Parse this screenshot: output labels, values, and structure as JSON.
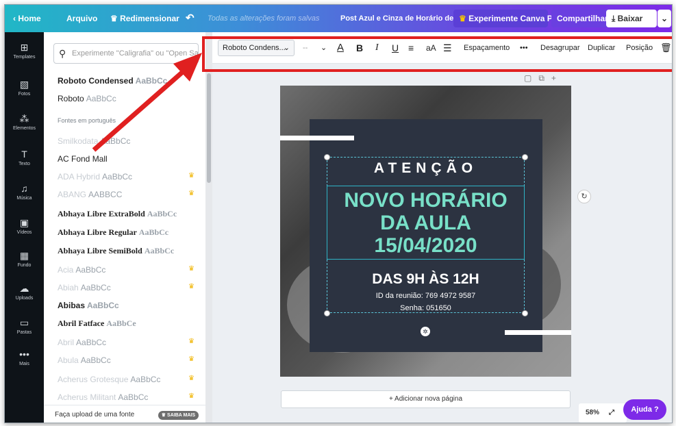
{
  "topbar": {
    "home": "Home",
    "arquivo": "Arquivo",
    "redimensionar": "Redimensionar",
    "saved_status": "Todas as alterações foram salvas",
    "doc_title": "Post Azul e Cinza de Horário de",
    "pro_label": "Experimente Canva Pro",
    "share_label": "Compartilhar",
    "download_label": "Baixar"
  },
  "rail": [
    {
      "label": "Templates",
      "icon": "templates-icon"
    },
    {
      "label": "Fotos",
      "icon": "photos-icon"
    },
    {
      "label": "Elementos",
      "icon": "elements-icon"
    },
    {
      "label": "Texto",
      "icon": "text-icon"
    },
    {
      "label": "Música",
      "icon": "music-icon"
    },
    {
      "label": "Vídeos",
      "icon": "video-icon"
    },
    {
      "label": "Fundo",
      "icon": "background-icon"
    },
    {
      "label": "Uploads",
      "icon": "upload-icon"
    },
    {
      "label": "Pastas",
      "icon": "folder-icon"
    },
    {
      "label": "Mais",
      "icon": "more-icon"
    }
  ],
  "panel": {
    "search_placeholder": "Experimente \"Caligrafia\" ou \"Open Sans\"",
    "section_label": "Fontes em português",
    "fonts_top": [
      {
        "name": "Roboto Condensed",
        "sample": "AaBbCc"
      },
      {
        "name": "Roboto",
        "sample": "AaBbCc"
      }
    ],
    "fonts": [
      {
        "name": "Smilkodata",
        "sample": "AaBbCc",
        "crown": false,
        "faded": true
      },
      {
        "name": "AC Fond Mall",
        "sample": "",
        "crown": false,
        "faded": false
      },
      {
        "name": "ADA Hybrid",
        "sample": "AaBbCc",
        "crown": true,
        "faded": true
      },
      {
        "name": "ABANG",
        "sample": "AABBCC",
        "crown": true,
        "faded": true
      },
      {
        "name": "Abhaya Libre ExtraBold",
        "sample": "AaBbCc",
        "crown": false,
        "faded": false
      },
      {
        "name": "Abhaya Libre Regular",
        "sample": "AaBbCc",
        "crown": false,
        "faded": false
      },
      {
        "name": "Abhaya Libre SemiBold",
        "sample": "AaBbCc",
        "crown": false,
        "faded": false
      },
      {
        "name": "Acia",
        "sample": "AaBbCc",
        "crown": true,
        "faded": true
      },
      {
        "name": "Abiah",
        "sample": "AaBbCc",
        "crown": true,
        "faded": true
      },
      {
        "name": "Abibas",
        "sample": "AaBbCc",
        "crown": false,
        "faded": false
      },
      {
        "name": "Abril Fatface",
        "sample": "AaBbCe",
        "crown": false,
        "faded": false
      },
      {
        "name": "Abril",
        "sample": "AaBbCc",
        "crown": true,
        "faded": true
      },
      {
        "name": "Abula",
        "sample": "AaBbCc",
        "crown": true,
        "faded": true
      },
      {
        "name": "Acherus Grotesque",
        "sample": "AaBbCc",
        "crown": true,
        "faded": true
      },
      {
        "name": "Acherus Militant",
        "sample": "AaBbCc",
        "crown": true,
        "faded": true
      }
    ],
    "upload_font": "Faça upload de uma fonte",
    "saiba_mais": "SAIBA MAIS"
  },
  "toolbar": {
    "font_name": "Roboto Condens...",
    "font_size": "--",
    "spacing": "Espaçamento",
    "more": "•••",
    "ungroup": "Desagrupar",
    "duplicate": "Duplicar",
    "position": "Posição"
  },
  "design": {
    "atencao": "ATENÇÃO",
    "line1": "NOVO HORÁRIO",
    "line2": "DA AULA",
    "line3": "15/04/2020",
    "hours": "DAS 9H ÀS 12H",
    "meeting_id": "ID da reunião: 769 4972 9587",
    "password": "Senha: 051650",
    "card_color": "#2c3341",
    "headline_color": "#78e0c8"
  },
  "canvas": {
    "add_page": "+ Adicionar nova página",
    "zoom": "58%",
    "help": "Ajuda ?"
  },
  "colors": {
    "highlight": "#e02020",
    "accent": "#7d2ae8"
  }
}
